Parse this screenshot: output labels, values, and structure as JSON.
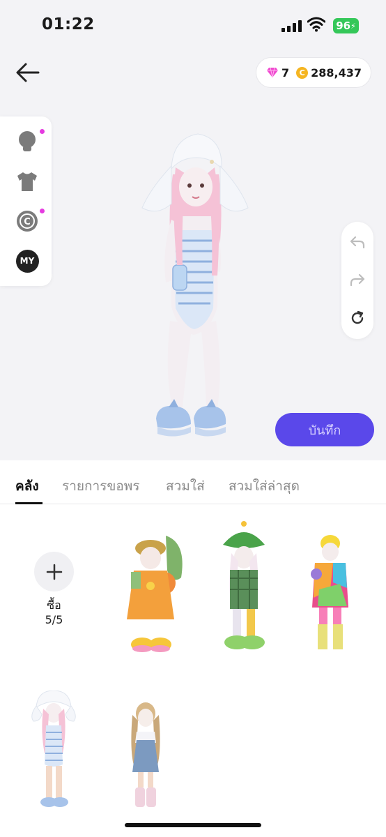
{
  "status": {
    "time": "01:22",
    "battery": "96"
  },
  "currency": {
    "gems": "7",
    "coin_symbol": "C",
    "coins": "288,437"
  },
  "sidebar": {
    "items": [
      {
        "name": "head",
        "icon": "head-icon",
        "has_dot": true
      },
      {
        "name": "clothing",
        "icon": "shirt-icon",
        "has_dot": false
      },
      {
        "name": "copyright",
        "icon": "copyright-icon",
        "has_dot": true
      },
      {
        "name": "my",
        "label": "MY"
      }
    ]
  },
  "history_toolbar": {
    "icons": [
      "undo-icon",
      "redo-icon",
      "reset-icon"
    ]
  },
  "save_button": {
    "label": "บันทึก"
  },
  "tabs": [
    {
      "label": "คลัง",
      "active": true
    },
    {
      "label": "รายการขอพร",
      "active": false
    },
    {
      "label": "สวมใส่",
      "active": false
    },
    {
      "label": "สวมใส่ล่าสุด",
      "active": false
    }
  ],
  "inventory": {
    "buy_label": "ซื้อ",
    "buy_count": "5/5",
    "outfits": [
      "outfit-fruit-hat",
      "outfit-frog-hat",
      "outfit-tie-dye",
      "outfit-swimsuit-hat",
      "outfit-denim-overalls"
    ]
  },
  "colors": {
    "accent": "#5a48ea",
    "dot": "#e53be0",
    "coin": "#f5b521",
    "battery": "#34c759"
  }
}
